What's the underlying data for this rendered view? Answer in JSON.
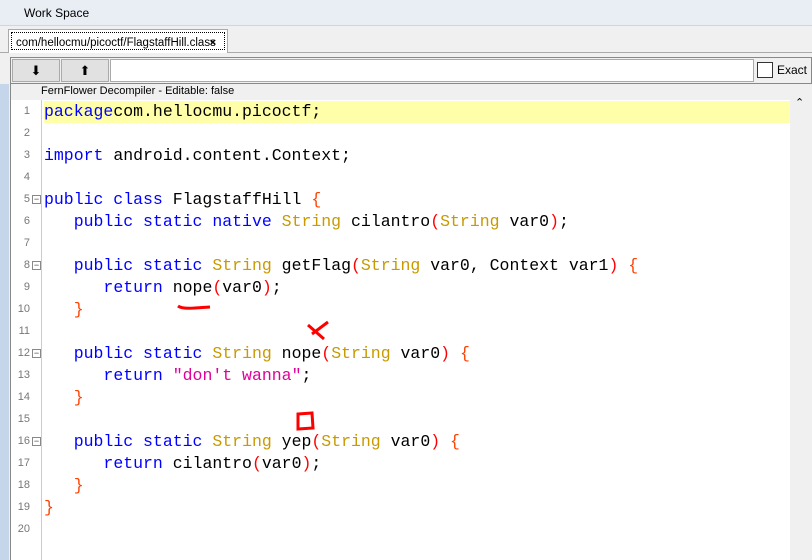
{
  "window": {
    "title": "Work Space"
  },
  "tab": {
    "label": "com/hellocmu/picoctf/FlagstaffHill.class",
    "close": "×"
  },
  "toolbar": {
    "download_icon": "⬇",
    "upload_icon": "⬆",
    "exact_label": "Exact"
  },
  "editor": {
    "header": "FernFlower Decompiler - Editable: false",
    "scroll_up": "⌃"
  },
  "lines": [
    {
      "n": "1",
      "hl": true,
      "t": [
        [
          "kw",
          "package"
        ],
        [
          "",
          "com.hellocmu.picoctf;"
        ]
      ]
    },
    {
      "n": "2",
      "t": []
    },
    {
      "n": "3",
      "t": [
        [
          "kw",
          "import"
        ],
        [
          "",
          " android.content.Context;"
        ]
      ]
    },
    {
      "n": "4",
      "t": []
    },
    {
      "n": "5",
      "fold": true,
      "t": [
        [
          "kw",
          "public class"
        ],
        [
          "",
          " FlagstaffHill "
        ],
        [
          "br",
          "{"
        ]
      ]
    },
    {
      "n": "6",
      "t": [
        [
          "",
          "   "
        ],
        [
          "kw",
          "public static native"
        ],
        [
          "",
          " "
        ],
        [
          "ty",
          "String"
        ],
        [
          "",
          " cilantro"
        ],
        [
          "pn",
          "("
        ],
        [
          "ty",
          "String"
        ],
        [
          "",
          " var0"
        ],
        [
          "pn",
          ")"
        ],
        [
          "",
          ";"
        ]
      ]
    },
    {
      "n": "7",
      "t": []
    },
    {
      "n": "8",
      "fold": true,
      "t": [
        [
          "",
          "   "
        ],
        [
          "kw",
          "public static"
        ],
        [
          "",
          " "
        ],
        [
          "ty",
          "String"
        ],
        [
          "",
          " getFlag"
        ],
        [
          "pn",
          "("
        ],
        [
          "ty",
          "String"
        ],
        [
          "",
          " var0, Context var1"
        ],
        [
          "pn",
          ")"
        ],
        [
          "",
          " "
        ],
        [
          "br",
          "{"
        ]
      ]
    },
    {
      "n": "9",
      "t": [
        [
          "",
          "      "
        ],
        [
          "kw",
          "return"
        ],
        [
          "",
          " nope"
        ],
        [
          "pn",
          "("
        ],
        [
          "",
          "var0"
        ],
        [
          "pn",
          ")"
        ],
        [
          "",
          ";"
        ]
      ]
    },
    {
      "n": "10",
      "t": [
        [
          "",
          "   "
        ],
        [
          "br",
          "}"
        ]
      ]
    },
    {
      "n": "11",
      "t": []
    },
    {
      "n": "12",
      "fold": true,
      "t": [
        [
          "",
          "   "
        ],
        [
          "kw",
          "public static"
        ],
        [
          "",
          " "
        ],
        [
          "ty",
          "String"
        ],
        [
          "",
          " nope"
        ],
        [
          "pn",
          "("
        ],
        [
          "ty",
          "String"
        ],
        [
          "",
          " var0"
        ],
        [
          "pn",
          ")"
        ],
        [
          "",
          " "
        ],
        [
          "br",
          "{"
        ]
      ]
    },
    {
      "n": "13",
      "t": [
        [
          "",
          "      "
        ],
        [
          "kw",
          "return"
        ],
        [
          "",
          " "
        ],
        [
          "st",
          "\"don't wanna\""
        ],
        [
          "",
          ";"
        ]
      ]
    },
    {
      "n": "14",
      "t": [
        [
          "",
          "   "
        ],
        [
          "br",
          "}"
        ]
      ]
    },
    {
      "n": "15",
      "t": []
    },
    {
      "n": "16",
      "fold": true,
      "t": [
        [
          "",
          "   "
        ],
        [
          "kw",
          "public static"
        ],
        [
          "",
          " "
        ],
        [
          "ty",
          "String"
        ],
        [
          "",
          " yep"
        ],
        [
          "pn",
          "("
        ],
        [
          "ty",
          "String"
        ],
        [
          "",
          " var0"
        ],
        [
          "pn",
          ")"
        ],
        [
          "",
          " "
        ],
        [
          "br",
          "{"
        ]
      ]
    },
    {
      "n": "17",
      "t": [
        [
          "",
          "      "
        ],
        [
          "kw",
          "return"
        ],
        [
          "",
          " cilantro"
        ],
        [
          "pn",
          "("
        ],
        [
          "",
          "var0"
        ],
        [
          "pn",
          ")"
        ],
        [
          "",
          ";"
        ]
      ]
    },
    {
      "n": "18",
      "t": [
        [
          "",
          "   "
        ],
        [
          "br",
          "}"
        ]
      ]
    },
    {
      "n": "19",
      "t": [
        [
          "br",
          "}"
        ]
      ]
    },
    {
      "n": "20",
      "t": []
    }
  ]
}
